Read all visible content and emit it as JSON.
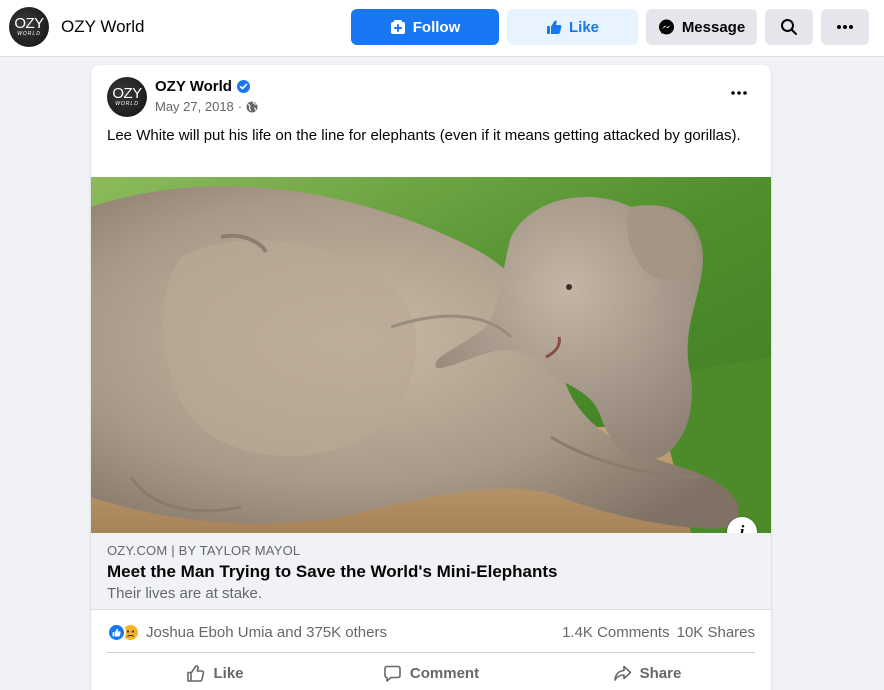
{
  "header": {
    "page_name": "OZY World",
    "avatar_text": "OZY",
    "avatar_subtext": "WORLD",
    "follow_label": "Follow",
    "like_label": "Like",
    "message_label": "Message"
  },
  "post": {
    "author": "OZY World",
    "date": "May 27, 2018",
    "separator": "·",
    "text": "Lee White will put his life on the line for elephants (even if it means getting attacked by gorillas).",
    "link": {
      "domain": "OZY.COM | BY TAYLOR MAYOL",
      "title": "Meet the Man Trying to Save the World's Mini-Elephants",
      "description": "Their lives are at stake."
    },
    "info_label": "i",
    "reactors": "Joshua Eboh Umia and 375K others",
    "comments": "1.4K Comments",
    "shares": "10K Shares",
    "actions": {
      "like": "Like",
      "comment": "Comment",
      "share": "Share"
    }
  },
  "colors": {
    "brand_blue": "#1877f2",
    "like_bg": "#e7f3ff",
    "secondary_bg": "#e4e6eb",
    "page_bg": "#f0f2f5"
  }
}
